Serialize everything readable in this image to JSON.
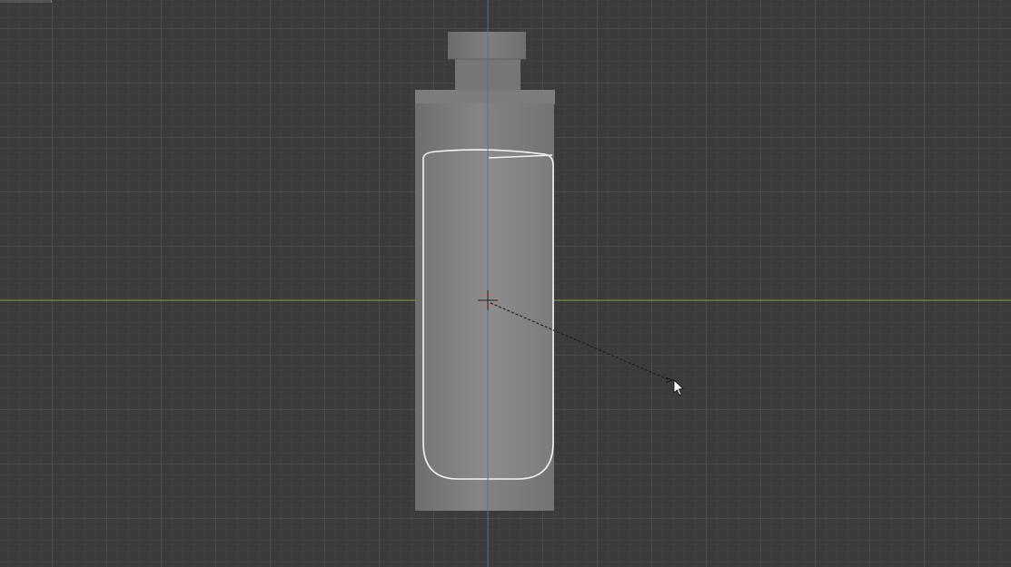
{
  "viewport": {
    "view": "front-orthographic",
    "grid": true,
    "colors": {
      "background": "#3b3b3b",
      "x_axis": "#7a9a3a",
      "z_axis": "#4a6fa5",
      "mesh": "#7a7a7a",
      "outline": "#ffffff"
    }
  },
  "scene": {
    "object": "bottle-mesh",
    "origin_icon": "3d-cursor-icon",
    "mouse_icon": "mouse-pointer-icon",
    "tool_line": "transform-dashed-line"
  }
}
